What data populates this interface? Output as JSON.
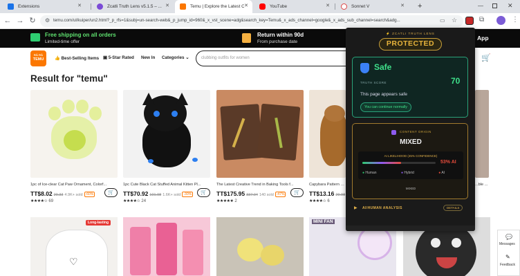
{
  "browser": {
    "tabs": [
      {
        "title": "Extensions",
        "icon_color": "#1a73e8",
        "icon": "puzzle-icon"
      },
      {
        "title": "Zcatli Truth Lens v5.1.5 – ...",
        "icon_color": "#7b4bd6",
        "icon": "lens-icon"
      },
      {
        "title": "Temu | Explore the Latest Clothi...",
        "icon_color": "#fb7701",
        "icon": "temu-icon",
        "active": true
      },
      {
        "title": "YouTube",
        "icon_color": "#ff0000",
        "icon": "youtube-icon"
      },
      {
        "title": "Sonnet V",
        "icon_color": "#d44",
        "icon": "sonnet-icon"
      }
    ],
    "new_tab": "+",
    "url": "temu.com/ul/kuiper/un2.html?_p_rfs=1&subj=un-search-web&_p_jump_id=960&_x_vst_scene=adg&search_key=Temu&_x_ads_channel=google&_x_ads_sub_channel=search&adg..."
  },
  "promo": {
    "left_title": "Free shipping on all orders",
    "left_sub": "Limited-time offer",
    "right_title": "Return within 90d",
    "right_sub": "From purchase date",
    "app_label": "App"
  },
  "header": {
    "logo_top": "ʀ∆ ʀ∆",
    "logo_bottom": "TEMU",
    "nav": [
      "Best-Selling Items",
      "5-Star Rated",
      "New In",
      "Categories"
    ],
    "search_placeholder": "clubbing outfits for women"
  },
  "results": {
    "title": "Result for \"temu\"",
    "products": [
      {
        "name": "1pc of Ice-clear Cat Paw Ornament, Colorf...",
        "price": "TT$8.02",
        "old": "20.33",
        "sold": "4.9K+ sold",
        "discount": "-60%",
        "stars": "★★★★☆",
        "reviews": "69"
      },
      {
        "name": "1pc Cute Black Cat Stuffed Animal Kitten Pl...",
        "price": "TT$70.92",
        "old": "101.98",
        "sold": "1.6K+ sold",
        "discount": "-30%",
        "stars": "★★★★☆",
        "reviews": "24"
      },
      {
        "name": "The Latest Creative Trend in Baking Tools f...",
        "price": "TT$175.95",
        "old": "337.04",
        "sold": "140 sold",
        "discount": "-47%",
        "stars": "★★★★★",
        "reviews": "2"
      },
      {
        "name": "Capybara Pattern K...",
        "price": "TT$13.16",
        "old": "29.98",
        "sold": "",
        "discount": "",
        "stars": "★★★★☆",
        "reviews": "6"
      },
      {
        "name": "...ble ...",
        "price": "",
        "old": "",
        "sold": "",
        "discount": "",
        "stars": "",
        "reviews": ""
      }
    ],
    "row2_badge": "Long-lasting",
    "row2_label": "MINI FAN"
  },
  "extension": {
    "brand": "⚡ ZCATLI TRUTH LENS",
    "badge": "PROTECTED",
    "status": "Safe",
    "truth_score_label": "TRUTH SCORE",
    "truth_score": "70",
    "message": "This page appears safe",
    "continue_label": "You can continue normally",
    "origin_label": "CONTENT ORIGIN",
    "origin_value": "MIXED",
    "ai_likelihood_label": "AI LIKELIHOOD (45% CONFIDENCE)",
    "ai_percent": "53% AI",
    "ai_fraction": 0.53,
    "legend": [
      "Human",
      "Hybrid",
      "AI"
    ],
    "legend_colors": [
      "#2ecc71",
      "#8e5bf0",
      "#e74c3c"
    ],
    "verdict": "MIXED",
    "analysis_label": "AI/HUMAN ANALYSIS",
    "details_label": "DETAILS"
  },
  "sidebar": {
    "messages": "Messages",
    "feedback": "Feedback"
  }
}
